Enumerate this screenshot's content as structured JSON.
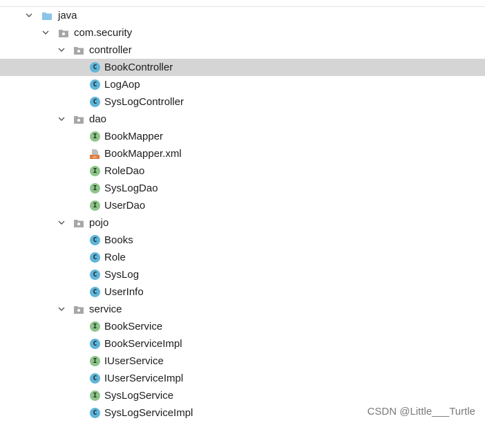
{
  "tree": {
    "root": {
      "label": "java",
      "icon": "folder-icon",
      "expanded": true
    },
    "package": {
      "label": "com.security",
      "icon": "package-icon",
      "expanded": true
    },
    "controller": {
      "label": "controller",
      "items": [
        {
          "label": "BookController",
          "type": "class",
          "badge": "C",
          "selected": true
        },
        {
          "label": "LogAop",
          "type": "class",
          "badge": "C"
        },
        {
          "label": "SysLogController",
          "type": "class",
          "badge": "C"
        }
      ]
    },
    "dao": {
      "label": "dao",
      "items": [
        {
          "label": "BookMapper",
          "type": "interface",
          "badge": "I"
        },
        {
          "label": "BookMapper.xml",
          "type": "xml-file"
        },
        {
          "label": "RoleDao",
          "type": "interface",
          "badge": "I"
        },
        {
          "label": "SysLogDao",
          "type": "interface",
          "badge": "I"
        },
        {
          "label": "UserDao",
          "type": "interface",
          "badge": "I"
        }
      ]
    },
    "pojo": {
      "label": "pojo",
      "items": [
        {
          "label": "Books",
          "type": "class",
          "badge": "C"
        },
        {
          "label": "Role",
          "type": "class",
          "badge": "C"
        },
        {
          "label": "SysLog",
          "type": "class",
          "badge": "C"
        },
        {
          "label": "UserInfo",
          "type": "class",
          "badge": "C"
        }
      ]
    },
    "service": {
      "label": "service",
      "items": [
        {
          "label": "BookService",
          "type": "interface",
          "badge": "I"
        },
        {
          "label": "BookServiceImpl",
          "type": "class",
          "badge": "C"
        },
        {
          "label": "IUserService",
          "type": "interface",
          "badge": "I"
        },
        {
          "label": "IUserServiceImpl",
          "type": "class",
          "badge": "C"
        },
        {
          "label": "SysLogService",
          "type": "interface",
          "badge": "I"
        },
        {
          "label": "SysLogServiceImpl",
          "type": "class",
          "badge": "C"
        }
      ]
    }
  },
  "watermark": "CSDN @Little___Turtle",
  "colors": {
    "selection": "#d5d5d5",
    "class_badge": "#5fb4d8",
    "interface_badge": "#8dc48a",
    "folder": "#8bc4e8",
    "xml_icon": "#e07c3e"
  }
}
